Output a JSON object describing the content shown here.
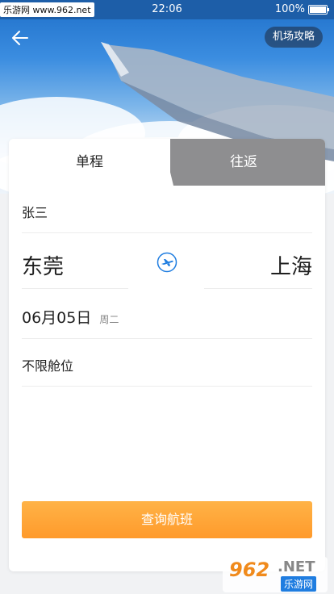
{
  "status_bar": {
    "site": "乐游网 www.962.net",
    "time": "22:06",
    "battery": "100%"
  },
  "header": {
    "guide_label": "机场攻略"
  },
  "tabs": {
    "one_way": "单程",
    "round_trip": "往返"
  },
  "form": {
    "passenger": "张三",
    "from_city": "东莞",
    "to_city": "上海",
    "date": "06月05日",
    "weekday": "周二",
    "cabin": "不限舱位"
  },
  "search_label": "查询航班",
  "watermark": {
    "number": "962",
    "net": ".NET",
    "cn": "乐游网"
  },
  "colors": {
    "accent": "#ff9a2b",
    "tab_inactive": "#8e8e90",
    "swap_icon": "#1f7de0"
  },
  "icons": {
    "back": "back-arrow-icon",
    "swap": "plane-swap-icon"
  }
}
